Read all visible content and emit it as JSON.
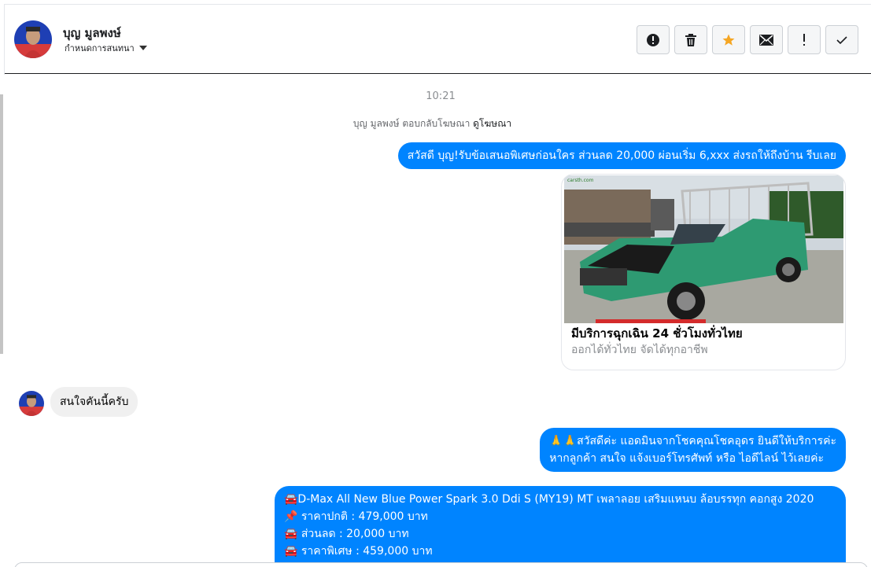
{
  "header": {
    "name": "บุญ มูลพงษ์",
    "subtitle": "กำหนดการสนทนา"
  },
  "actions": [
    {
      "icon": "alert-circle-icon"
    },
    {
      "icon": "trash-icon"
    },
    {
      "icon": "star-icon",
      "color": "#f5a623"
    },
    {
      "icon": "envelope-icon"
    },
    {
      "icon": "exclamation-icon"
    },
    {
      "icon": "check-icon"
    }
  ],
  "conversation": {
    "timestamp": "10:21",
    "ad_reply": {
      "text": "บุญ มูลพงษ์ ตอบกลับโฆษณา",
      "link": "ดูโฆษณา"
    },
    "messages": {
      "m1": "สวัสดี บุญ!รับข้อเสนอพิเศษก่อนใคร ส่วนลด 20,000 ผ่อนเริ่ม 6,xxx ส่งรถให้ถึงบ้าน รีบเลย",
      "card": {
        "title": "มีบริการฉุกเฉิน 24 ชั่วโมงทั่วไทย",
        "subtitle": "ออกได้ทั่วไทย จัดได้ทุกอาชีพ",
        "watermark": "carsth.com"
      },
      "m2": "สนใจคันนี้ครับ",
      "m3_line1": "🙏🙏สวัสดีค่ะ แอดมินจากโชคคุณโชคอุดร ยินดีให้บริการค่ะ",
      "m3_line2": "หากลูกค้า สนใจ แจ้งเบอร์โทรศัพท์ หรือ ไอดีไลน์  ไว้เลยค่ะ",
      "m4_line1": "🚘D-Max All New Blue Power Spark 3.0 Ddi S (MY19) MT เพลาลอย เสริมแหนบ ล้อบรรทุก คอกสูง 2020",
      "m4_line2": "📌 ราคาปกติ : 479,000 บาท",
      "m4_line3": "🚘 ส่วนลด : 20,000 บาท",
      "m4_line4": "🚘 ราคาพิเศษ : 459,000 บาท"
    }
  },
  "colors": {
    "outgoing_bubble": "#0084ff",
    "incoming_bubble": "#f0f0f0",
    "star": "#f5a623"
  }
}
